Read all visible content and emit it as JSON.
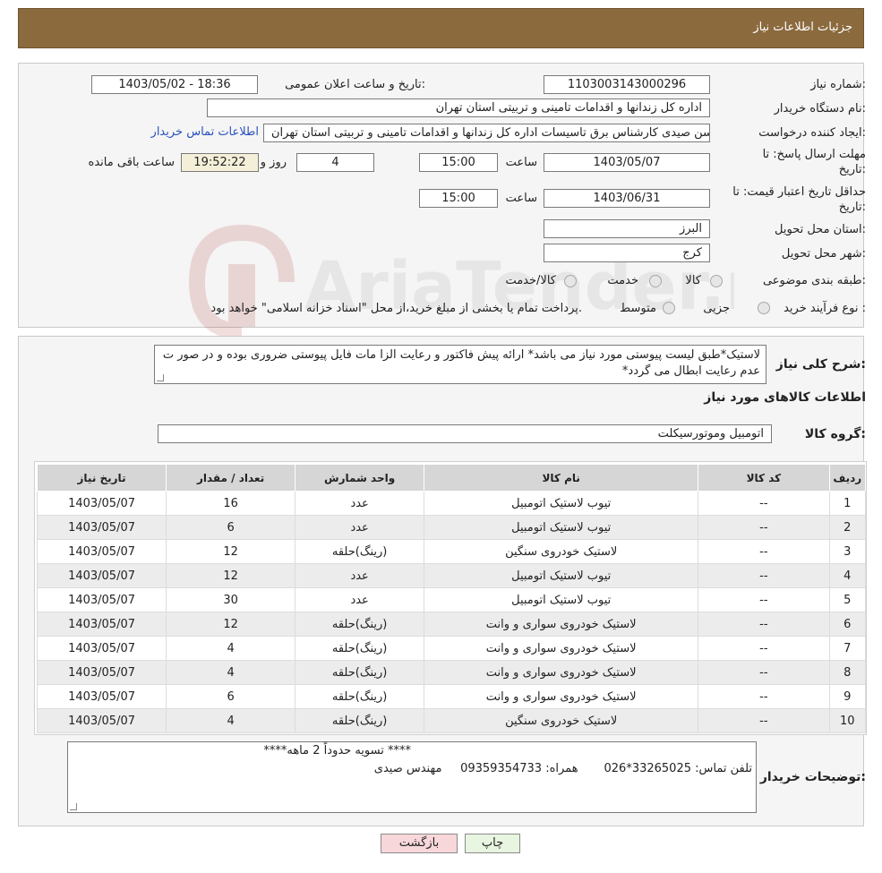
{
  "header": {
    "title": "جزئیات اطلاعات نیاز"
  },
  "info": {
    "need_number_label": "شماره نیاز:",
    "need_number": "1103003143000296",
    "announce_label": "تاریخ و ساعت اعلان عمومی:",
    "announce_value": "1403/05/02 - 18:36",
    "buyer_org_label": "نام دستگاه خریدار:",
    "buyer_org": "اداره کل زندانها و اقدامات تامینی و تربیتی استان تهران",
    "requester_label": "ایجاد کننده درخواست:",
    "requester": "محسن صیدی کارشناس برق تاسیسات  اداره کل زندانها و اقدامات تامینی و تربیتی استان تهران",
    "contact_link": "اطلاعات تماس خریدار",
    "deadline_label_1": "مهلت ارسال پاسخ: تا",
    "deadline_label_2": "تاریخ:",
    "deadline_date": "1403/05/07",
    "time_label": "ساعت",
    "deadline_time": "15:00",
    "days_value": "4",
    "days_label": "روز و",
    "remaining_time": "19:52:22",
    "remaining_label": "ساعت باقی مانده",
    "validity_label_1": "حداقل تاریخ اعتبار قیمت: تا",
    "validity_label_2": "تاریخ:",
    "validity_date": "1403/06/31",
    "validity_time_label": "ساعت",
    "validity_time": "15:00",
    "province_label": "استان محل تحویل:",
    "province": "البرز",
    "city_label": "شهر محل تحویل:",
    "city": "کرج",
    "category_label": "طبقه بندی موضوعی:",
    "category_options": [
      "کالا",
      "خدمت",
      "کالا/خدمت"
    ],
    "process_label": "نوع فرآیند خرید :",
    "process_options": [
      "جزیی",
      "متوسط"
    ],
    "process_note": "پرداخت تمام یا بخشی از مبلغ خرید،از محل \"اسناد خزانه اسلامی\" خواهد بود."
  },
  "description": {
    "label": "شرح کلی نیاز:",
    "text": "لاستیک*طبق لیست پیوستی مورد نیاز می باشد* ارائه پیش فاکتور و رعایت الزا مات فایل پیوستی ضروری بوده و در صور ت عدم رعایت ابطال می گردد*"
  },
  "goods": {
    "section_title": "اطلاعات کالاهای مورد نیاز",
    "group_label": "گروه کالا:",
    "group_value": "اتومبیل وموتورسیکلت",
    "columns": [
      "ردیف",
      "کد کالا",
      "نام کالا",
      "واحد شمارش",
      "تعداد / مقدار",
      "تاریخ نیاز"
    ],
    "rows": [
      [
        "1",
        "--",
        "تیوب لاستیک اتومبیل",
        "عدد",
        "16",
        "1403/05/07"
      ],
      [
        "2",
        "--",
        "تیوب لاستیک اتومبیل",
        "عدد",
        "6",
        "1403/05/07"
      ],
      [
        "3",
        "--",
        "لاستیک خودروی سنگین",
        "(رینگ)حلقه",
        "12",
        "1403/05/07"
      ],
      [
        "4",
        "--",
        "تیوب لاستیک اتومبیل",
        "عدد",
        "12",
        "1403/05/07"
      ],
      [
        "5",
        "--",
        "تیوب لاستیک اتومبیل",
        "عدد",
        "30",
        "1403/05/07"
      ],
      [
        "6",
        "--",
        "لاستیک خودروی سواری و وانت",
        "(رینگ)حلقه",
        "12",
        "1403/05/07"
      ],
      [
        "7",
        "--",
        "لاستیک خودروی سواری و وانت",
        "(رینگ)حلقه",
        "4",
        "1403/05/07"
      ],
      [
        "8",
        "--",
        "لاستیک خودروی سواری و وانت",
        "(رینگ)حلقه",
        "4",
        "1403/05/07"
      ],
      [
        "9",
        "--",
        "لاستیک خودروی سواری و وانت",
        "(رینگ)حلقه",
        "6",
        "1403/05/07"
      ],
      [
        "10",
        "--",
        "لاستیک خودروی سنگین",
        "(رینگ)حلقه",
        "4",
        "1403/05/07"
      ]
    ]
  },
  "buyer_notes": {
    "label": "توضیحات خریدار:",
    "line1": "**** تسویه حدوداً 2 ماهه****",
    "line2": "تلفن تماس: 33265025*026       همراه: 09359354733     مهندس صیدی"
  },
  "buttons": {
    "print": "چاپ",
    "back": "بازگشت"
  },
  "watermark": {
    "text": "AriaTender.neT"
  },
  "colors": {
    "header": "#8b6a3e",
    "link": "#2a52be",
    "back_button": "#f7d7da",
    "print_button": "#e8f5e0"
  }
}
